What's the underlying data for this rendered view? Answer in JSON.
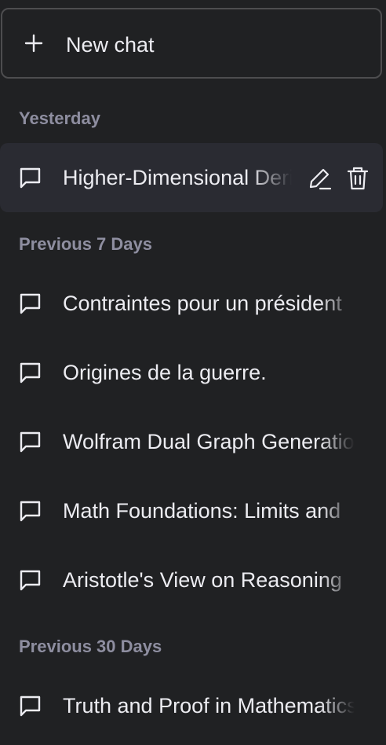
{
  "new_chat": {
    "label": "New chat",
    "icon": "plus-icon"
  },
  "sections": [
    {
      "title": "Yesterday",
      "items": [
        {
          "title": "Higher-Dimensional Derivatives",
          "active": true,
          "actions": [
            "edit-icon",
            "delete-icon"
          ]
        }
      ]
    },
    {
      "title": "Previous 7 Days",
      "items": [
        {
          "title": "Contraintes pour un président"
        },
        {
          "title": "Origines de la guerre."
        },
        {
          "title": "Wolfram Dual Graph Generation"
        },
        {
          "title": "Math Foundations: Limits and"
        },
        {
          "title": "Aristotle's View on Reasoning"
        }
      ]
    },
    {
      "title": "Previous 30 Days",
      "items": [
        {
          "title": "Truth and Proof in Mathematics"
        }
      ]
    }
  ],
  "colors": {
    "background": "#202123",
    "active_item": "#2a2b32",
    "section_title": "#8e8ea0",
    "text": "#ececf1",
    "border": "#4d4d4f"
  }
}
